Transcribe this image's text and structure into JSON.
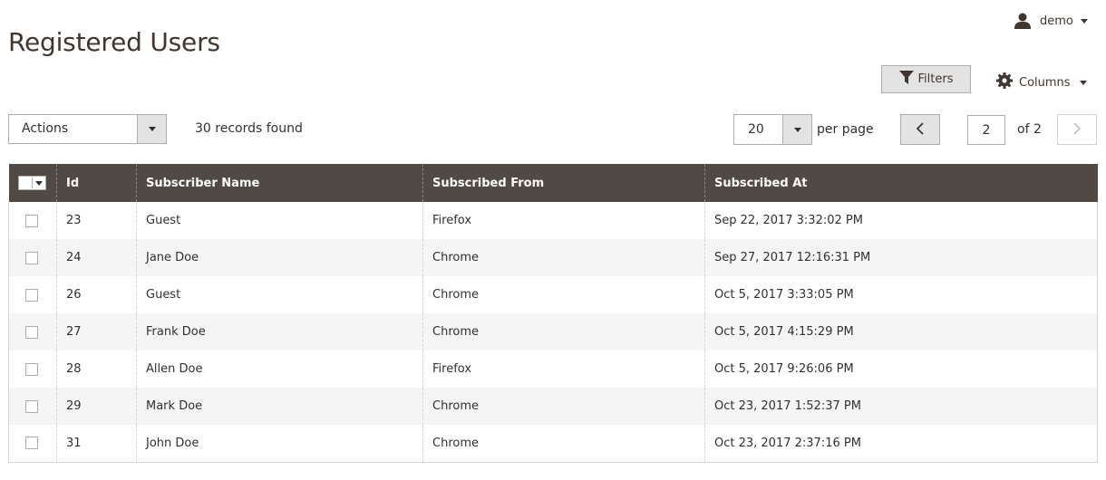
{
  "header": {
    "title": "Registered Users",
    "user_name": "demo"
  },
  "toolbar": {
    "filters_label": "Filters",
    "columns_label": "Columns",
    "actions_value": "Actions",
    "records_text": "30 records found",
    "per_page_value": "20",
    "per_page_label": "per page",
    "current_page": "2",
    "page_of": "of 2"
  },
  "grid": {
    "columns": [
      "Id",
      "Subscriber Name",
      "Subscribed From",
      "Subscribed At"
    ],
    "rows": [
      {
        "id": "23",
        "name": "Guest",
        "from": "Firefox",
        "at": "Sep 22, 2017 3:32:02 PM"
      },
      {
        "id": "24",
        "name": "Jane Doe",
        "from": "Chrome",
        "at": "Sep 27, 2017 12:16:31 PM"
      },
      {
        "id": "26",
        "name": "Guest",
        "from": "Chrome",
        "at": "Oct 5, 2017 3:33:05 PM"
      },
      {
        "id": "27",
        "name": "Frank Doe",
        "from": "Chrome",
        "at": "Oct 5, 2017 4:15:29 PM"
      },
      {
        "id": "28",
        "name": "Allen Doe",
        "from": "Firefox",
        "at": "Oct 5, 2017 9:26:06 PM"
      },
      {
        "id": "29",
        "name": "Mark Doe",
        "from": "Chrome",
        "at": "Oct 23, 2017 1:52:37 PM"
      },
      {
        "id": "31",
        "name": "John Doe",
        "from": "Chrome",
        "at": "Oct 23, 2017 2:37:16 PM"
      }
    ]
  },
  "colors": {
    "header_bg": "#514943",
    "title_color": "#41362f",
    "button_bg": "#e3e3e3",
    "row_alt_bg": "#f5f5f5"
  },
  "icons": {
    "user": "user-icon",
    "filter": "funnel-icon",
    "columns": "gear-icon",
    "prev": "chevron-left-icon",
    "next": "chevron-right-icon"
  }
}
